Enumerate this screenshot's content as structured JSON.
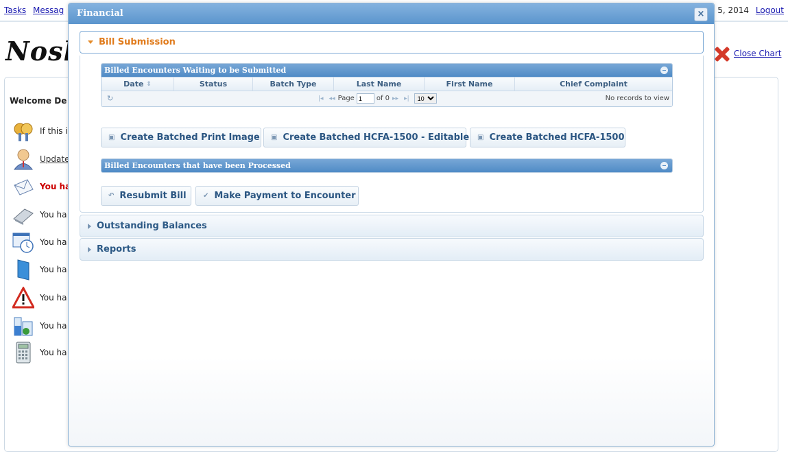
{
  "top": {
    "tasks": "Tasks",
    "messages": "Messag",
    "date": "5, 2014",
    "logout": "Logout"
  },
  "logo": "Nosh",
  "close_chart": "Close Chart",
  "welcome": "Welcome De",
  "rows": [
    {
      "icon": "keys-icon",
      "text": "If this is"
    },
    {
      "icon": "user-icon",
      "text": "Update"
    },
    {
      "icon": "envelope-icon",
      "text": "You ha"
    },
    {
      "icon": "scanner-icon",
      "text": "You ha"
    },
    {
      "icon": "clock-window-icon",
      "text": "You ha"
    },
    {
      "icon": "book-icon",
      "text": "You ha"
    },
    {
      "icon": "warning-icon",
      "text": "You ha"
    },
    {
      "icon": "lab-icon",
      "text": "You ha"
    },
    {
      "icon": "calculator-icon",
      "text": "You ha"
    }
  ],
  "modal": {
    "title": "Financial",
    "close": "×",
    "sections": {
      "bill": "Bill Submission",
      "outstanding": "Outstanding Balances",
      "reports": "Reports"
    },
    "grid1": {
      "caption": "Billed Encounters Waiting to be Submitted",
      "headers": [
        "Date",
        "Status",
        "Batch Type",
        "Last Name",
        "First Name",
        "Chief Complaint"
      ],
      "page_label": "Page",
      "page_value": "1",
      "of": "of 0",
      "rows_per_page": "10",
      "empty": "No records to view"
    },
    "buttons1": {
      "print": "Create Batched Print Image",
      "hcfa_edit": "Create Batched HCFA-1500 - Editable",
      "hcfa": "Create Batched HCFA-1500"
    },
    "grid2": {
      "caption": "Billed Encounters that have been Processed"
    },
    "buttons2": {
      "resubmit": "Resubmit Bill",
      "payment": "Make Payment to Encounter"
    }
  }
}
